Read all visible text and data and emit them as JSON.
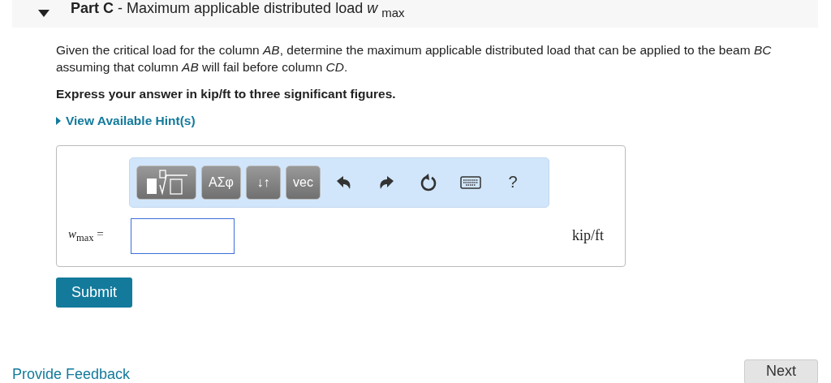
{
  "part": {
    "expanded": true,
    "title": "**Part C** - Maximum applicable distributed load *w* $_{max}$"
  },
  "question": "Given the critical load for the column *AB*, determine the maximum applicable distributed load that can be applied to the beam *BC* assuming that column *AB* will fail before column *CD*.",
  "instruction": "Express your answer in kip/ft to three significant figures.",
  "hints": {
    "label": "View Available Hint(s)",
    "expanded": false
  },
  "toolbar": [
    {
      "kind": "template"
    },
    {
      "kind": "text",
      "label": "ΑΣφ"
    },
    {
      "kind": "text",
      "label": "↓↑"
    },
    {
      "kind": "text",
      "label": "vec"
    },
    {
      "kind": "undo"
    },
    {
      "kind": "redo"
    },
    {
      "kind": "reset"
    },
    {
      "kind": "keyboard"
    },
    {
      "kind": "help",
      "label": "?"
    }
  ],
  "answer": {
    "label": "*w*$_{max}$ =",
    "units": "kip/ft"
  },
  "submit": "Submit",
  "feedback": "Provide Feedback",
  "next": "Next"
}
